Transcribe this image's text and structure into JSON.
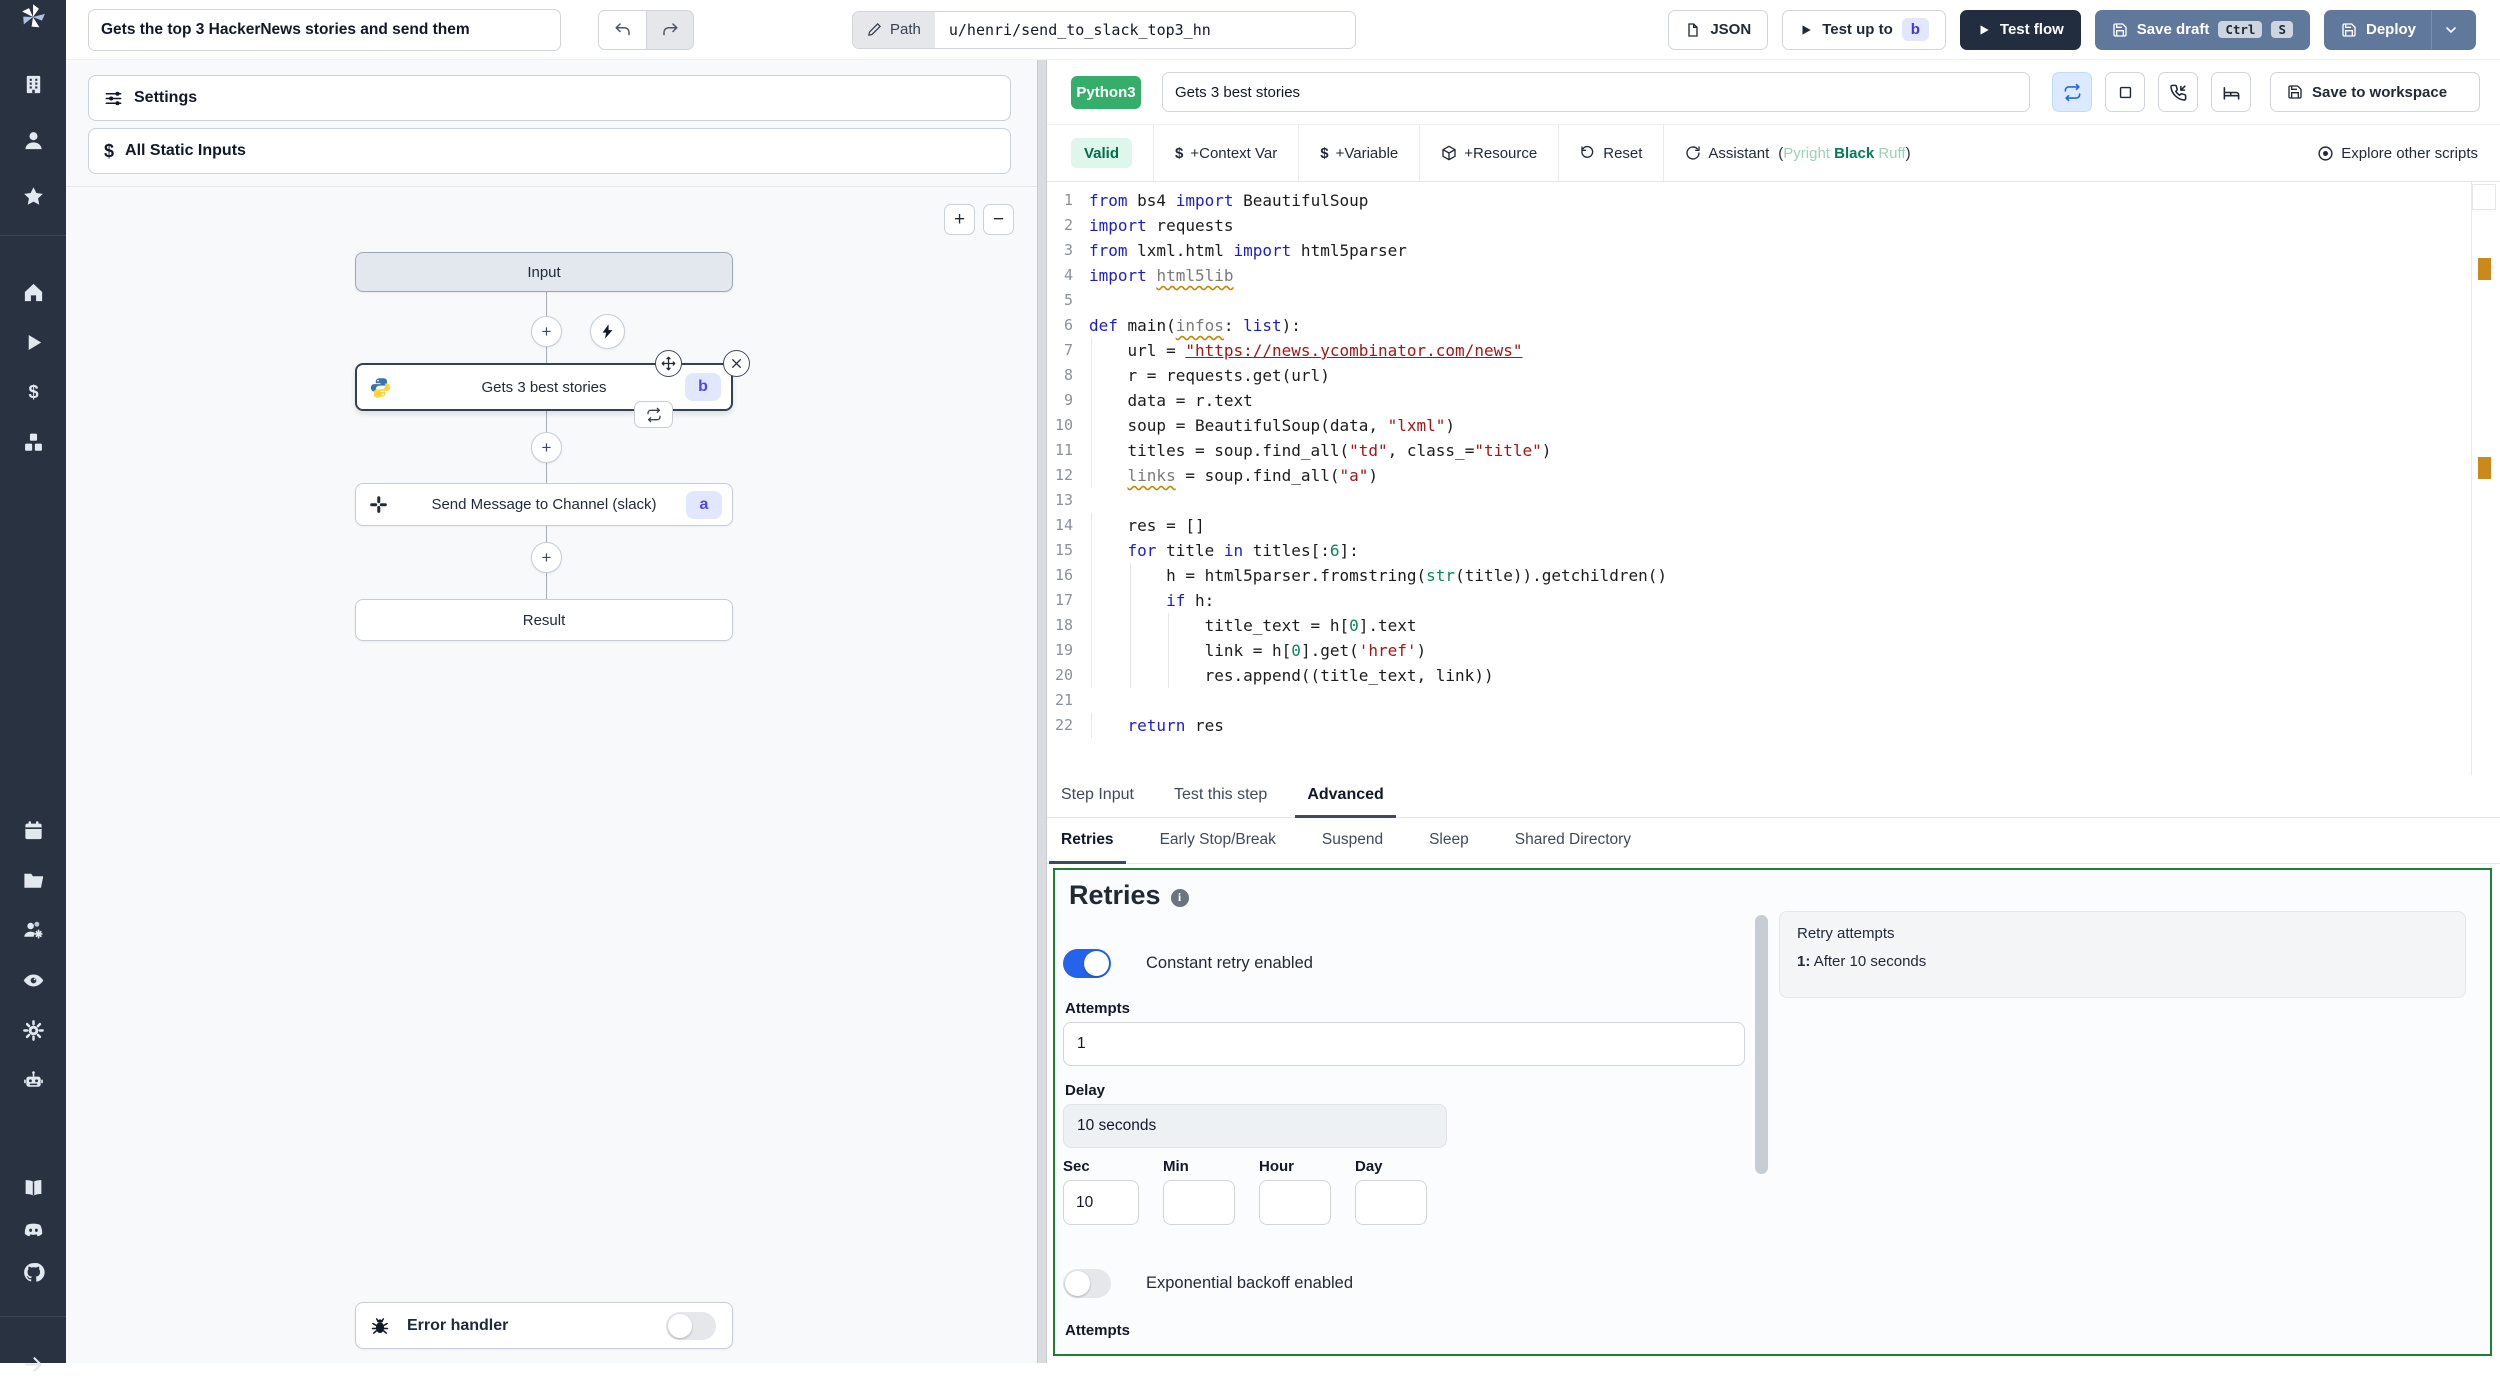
{
  "topbar": {
    "flow_title": "Gets the top 3 HackerNews stories and send them",
    "path_label": "Path",
    "path_value": "u/henri/send_to_slack_top3_hn",
    "json_button": "JSON",
    "test_up_to": "Test up to",
    "test_up_to_badge": "b",
    "test_flow": "Test flow",
    "save_draft": "Save draft",
    "save_draft_keys": [
      "Ctrl",
      "S"
    ],
    "deploy": "Deploy"
  },
  "sidebar": {
    "icon_groups": [
      [
        "building",
        "user",
        "star"
      ],
      [
        "home",
        "play",
        "dollar",
        "cubes"
      ],
      [
        "calendar",
        "folder",
        "users-gear",
        "eye",
        "gear",
        "robot"
      ],
      [
        "book",
        "discord",
        "github"
      ],
      [
        "arrow-right"
      ]
    ]
  },
  "flow": {
    "settings_label": "Settings",
    "static_inputs_label": "All Static Inputs",
    "zoom_in": "+",
    "zoom_out": "−",
    "input_node": "Input",
    "step1": {
      "title": "Gets 3 best stories",
      "badge": "b"
    },
    "step2": {
      "title": "Send Message to Channel (slack)",
      "badge": "a"
    },
    "result_node": "Result",
    "error_handler": "Error handler"
  },
  "editor": {
    "lang_badge": "Python3",
    "title_value": "Gets 3 best stories",
    "save_workspace": "Save to workspace",
    "toolbar": {
      "valid": "Valid",
      "context_var": "+Context Var",
      "variable": "+Variable",
      "resource": "+Resource",
      "reset": "Reset",
      "assistant": "Assistant",
      "assistant_open": "(",
      "assistant_close": ")",
      "assistant_tools": [
        "Pyright",
        "Black",
        "Ruff"
      ],
      "explore": "Explore other scripts"
    },
    "code": {
      "lines": [
        [
          {
            "c": "k",
            "t": "from"
          },
          {
            "c": "p",
            "t": " bs4 "
          },
          {
            "c": "k",
            "t": "import"
          },
          {
            "c": "p",
            "t": " BeautifulSoup"
          }
        ],
        [
          {
            "c": "k",
            "t": "import"
          },
          {
            "c": "p",
            "t": " requests"
          }
        ],
        [
          {
            "c": "k",
            "t": "from"
          },
          {
            "c": "p",
            "t": " lxml.html "
          },
          {
            "c": "k",
            "t": "import"
          },
          {
            "c": "p",
            "t": " html5parser"
          }
        ],
        [
          {
            "c": "k",
            "t": "import"
          },
          {
            "c": "p",
            "t": " "
          },
          {
            "c": "w",
            "t": "html5lib"
          }
        ],
        [],
        [
          {
            "c": "k",
            "t": "def"
          },
          {
            "c": "p",
            "t": " main("
          },
          {
            "c": "w",
            "t": "infos"
          },
          {
            "c": "p",
            "t": ": "
          },
          {
            "c": "k",
            "t": "list"
          },
          {
            "c": "p",
            "t": "):"
          }
        ],
        [
          {
            "c": "p",
            "t": "    url = "
          },
          {
            "c": "sl",
            "t": "\"https://news.ycombinator.com/news\""
          }
        ],
        [
          {
            "c": "p",
            "t": "    r = requests.get(url)"
          }
        ],
        [
          {
            "c": "p",
            "t": "    data = r.text"
          }
        ],
        [
          {
            "c": "p",
            "t": "    soup = BeautifulSoup(data, "
          },
          {
            "c": "s",
            "t": "\"lxml\""
          },
          {
            "c": "p",
            "t": ")"
          }
        ],
        [
          {
            "c": "p",
            "t": "    titles = soup.find_all("
          },
          {
            "c": "s",
            "t": "\"td\""
          },
          {
            "c": "p",
            "t": ", class_="
          },
          {
            "c": "s",
            "t": "\"title\""
          },
          {
            "c": "p",
            "t": ")"
          }
        ],
        [
          {
            "c": "p",
            "t": "    "
          },
          {
            "c": "w",
            "t": "links"
          },
          {
            "c": "p",
            "t": " = soup.find_all("
          },
          {
            "c": "s",
            "t": "\"a\""
          },
          {
            "c": "p",
            "t": ")"
          }
        ],
        [],
        [
          {
            "c": "p",
            "t": "    res = []"
          }
        ],
        [
          {
            "c": "p",
            "t": "    "
          },
          {
            "c": "k",
            "t": "for"
          },
          {
            "c": "p",
            "t": " title "
          },
          {
            "c": "k",
            "t": "in"
          },
          {
            "c": "p",
            "t": " titles[:"
          },
          {
            "c": "n",
            "t": "6"
          },
          {
            "c": "p",
            "t": "]:"
          }
        ],
        [
          {
            "c": "p",
            "t": "        h = html5parser.fromstring("
          },
          {
            "c": "f",
            "t": "str"
          },
          {
            "c": "p",
            "t": "(title)).getchildren()"
          }
        ],
        [
          {
            "c": "p",
            "t": "        "
          },
          {
            "c": "k",
            "t": "if"
          },
          {
            "c": "p",
            "t": " h:"
          }
        ],
        [
          {
            "c": "p",
            "t": "            title_text = h["
          },
          {
            "c": "n",
            "t": "0"
          },
          {
            "c": "p",
            "t": "].text"
          }
        ],
        [
          {
            "c": "p",
            "t": "            link = h["
          },
          {
            "c": "n",
            "t": "0"
          },
          {
            "c": "p",
            "t": "].get("
          },
          {
            "c": "s",
            "t": "'href'"
          },
          {
            "c": "p",
            "t": ")"
          }
        ],
        [
          {
            "c": "p",
            "t": "            res.append((title_text, link))"
          }
        ],
        [],
        [
          {
            "c": "p",
            "t": "    "
          },
          {
            "c": "k",
            "t": "return"
          },
          {
            "c": "p",
            "t": " res"
          }
        ]
      ]
    }
  },
  "tabs": {
    "main": [
      "Step Input",
      "Test this step",
      "Advanced"
    ],
    "main_active": "Advanced",
    "sub": [
      "Retries",
      "Early Stop/Break",
      "Suspend",
      "Sleep",
      "Shared Directory"
    ],
    "sub_active": "Retries"
  },
  "retries": {
    "heading": "Retries",
    "constant_label": "Constant retry enabled",
    "attempts_label": "Attempts",
    "attempts_value": "1",
    "delay_label": "Delay",
    "delay_value": "10 seconds",
    "units": [
      "Sec",
      "Min",
      "Hour",
      "Day"
    ],
    "sec_value": "10",
    "exponential_label": "Exponential backoff enabled",
    "attempts2_label": "Attempts",
    "summary": {
      "title": "Retry attempts",
      "item_index": "1:",
      "item_text": "After 10 seconds"
    }
  },
  "colors": {
    "sidebar_bg": "#293241",
    "accent_green_border": "#1a7f37",
    "toggle_on_blue": "#2563eb",
    "badge_bg": "#e0e7ff",
    "badge_text": "#4f46e5",
    "python_badge_green": "#35ad6b",
    "slate_button": "#60789b",
    "dark_button": "#222e3f",
    "valid_bg": "#def7ec",
    "valid_text": "#046c4e",
    "warn_mark": "#c98a1b"
  }
}
